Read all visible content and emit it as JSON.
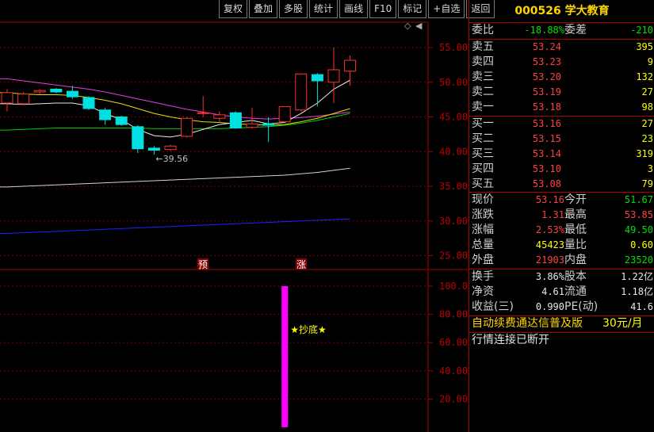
{
  "toolbar": [
    "复权",
    "叠加",
    "多股",
    "统计",
    "画线",
    "F10",
    "标记",
    "+自选",
    "返回"
  ],
  "price_axis": [
    "55.00",
    "50.00",
    "45.00",
    "40.00",
    "35.00",
    "30.00",
    "25.00"
  ],
  "indicator_axis": [
    "100.00",
    "80.00",
    "60.00",
    "40.00",
    "20.00"
  ],
  "markers": {
    "yu": "预",
    "zhang": "涨"
  },
  "low_label": "39.56",
  "signal_label": "★抄底★",
  "chart_data": {
    "type": "candlestick",
    "candles": [
      {
        "o": 47.0,
        "c": 48.5,
        "h": 49.0,
        "l": 45.8
      },
      {
        "o": 46.9,
        "c": 48.3,
        "h": 48.6,
        "l": 46.7
      },
      {
        "o": 48.6,
        "c": 48.8,
        "h": 49.0,
        "l": 48.3
      },
      {
        "o": 49.0,
        "c": 48.6,
        "h": 49.2,
        "l": 48.4
      },
      {
        "o": 48.7,
        "c": 47.9,
        "h": 49.5,
        "l": 47.6
      },
      {
        "o": 47.8,
        "c": 46.2,
        "h": 48.0,
        "l": 46.0
      },
      {
        "o": 46.0,
        "c": 44.6,
        "h": 46.3,
        "l": 43.9
      },
      {
        "o": 45.0,
        "c": 43.9,
        "h": 45.2,
        "l": 43.7
      },
      {
        "o": 43.6,
        "c": 40.4,
        "h": 43.8,
        "l": 39.8
      },
      {
        "o": 40.5,
        "c": 40.2,
        "h": 40.8,
        "l": 39.56
      },
      {
        "o": 40.3,
        "c": 40.8,
        "h": 41.0,
        "l": 40.1
      },
      {
        "o": 42.2,
        "c": 44.8,
        "h": 45.0,
        "l": 42.0
      },
      {
        "o": 45.6,
        "c": 45.6,
        "h": 48.0,
        "l": 45.0
      },
      {
        "o": 44.8,
        "c": 45.3,
        "h": 45.8,
        "l": 44.2
      },
      {
        "o": 45.6,
        "c": 43.4,
        "h": 45.8,
        "l": 43.3
      },
      {
        "o": 43.5,
        "c": 44.0,
        "h": 46.3,
        "l": 43.3
      },
      {
        "o": 44.0,
        "c": 43.8,
        "h": 45.0,
        "l": 41.4
      },
      {
        "o": 44.3,
        "c": 46.5,
        "h": 46.5,
        "l": 44.2
      },
      {
        "o": 46.0,
        "c": 51.2,
        "h": 51.3,
        "l": 45.8
      },
      {
        "o": 51.1,
        "c": 50.2,
        "h": 51.3,
        "l": 46.5
      },
      {
        "o": 50.0,
        "c": 51.8,
        "h": 55.0,
        "l": 47.0
      },
      {
        "o": 51.6,
        "c": 53.16,
        "h": 53.85,
        "l": 49.5
      }
    ],
    "ma_white": [
      46.9,
      46.8,
      46.9,
      47.0,
      47.0,
      46.6,
      45.5,
      44.6,
      43.2,
      42.3,
      42.1,
      42.5,
      43.2,
      43.9,
      44.2,
      44.5,
      44.0,
      44.2,
      45.5,
      47.0,
      49.0,
      50.3
    ],
    "ma_yellow": [
      48.5,
      48.3,
      48.2,
      48.2,
      48.1,
      47.8,
      47.4,
      46.9,
      46.2,
      45.5,
      45.0,
      44.6,
      44.3,
      44.2,
      44.0,
      43.9,
      43.8,
      43.9,
      44.3,
      44.8,
      45.5,
      46.2
    ],
    "ma_magenta": [
      50.5,
      50.2,
      49.9,
      49.6,
      49.3,
      49.0,
      48.6,
      48.1,
      47.6,
      47.1,
      46.6,
      46.1,
      45.7,
      45.3,
      45.0,
      44.8,
      44.7,
      44.8,
      44.9,
      45.1,
      45.4,
      45.7
    ],
    "ma_green": [
      43.1,
      43.2,
      43.3,
      43.4,
      43.4,
      43.4,
      43.4,
      43.4,
      43.4,
      43.3,
      43.3,
      43.3,
      43.3,
      43.3,
      43.4,
      43.5,
      43.6,
      43.8,
      44.1,
      44.5,
      45.0,
      45.5
    ],
    "ma_long_white": [
      34.9,
      35.0,
      35.1,
      35.2,
      35.3,
      35.4,
      35.5,
      35.6,
      35.7,
      35.8,
      35.9,
      36.0,
      36.1,
      36.2,
      36.3,
      36.4,
      36.5,
      36.6,
      36.8,
      37.0,
      37.3,
      37.6
    ],
    "ma_blue": [
      28.2,
      28.3,
      28.4,
      28.5,
      28.6,
      28.7,
      28.8,
      28.9,
      29.0,
      29.1,
      29.2,
      29.3,
      29.4,
      29.5,
      29.6,
      29.7,
      29.8,
      29.9,
      30.0,
      30.1,
      30.2,
      30.3
    ],
    "indicator_bar": {
      "index": 17,
      "value": 100
    }
  },
  "info": {
    "code_name": "000526 学大教育",
    "weibi": {
      "l1": "委比",
      "v1": "-18.88%",
      "l2": "委差",
      "v2": "-210"
    },
    "sells": [
      {
        "label": "卖五",
        "price": "53.24",
        "vol": "395"
      },
      {
        "label": "卖四",
        "price": "53.23",
        "vol": "9"
      },
      {
        "label": "卖三",
        "price": "53.20",
        "vol": "132"
      },
      {
        "label": "卖二",
        "price": "53.19",
        "vol": "27"
      },
      {
        "label": "卖一",
        "price": "53.18",
        "vol": "98"
      }
    ],
    "buys": [
      {
        "label": "买一",
        "price": "53.16",
        "vol": "27"
      },
      {
        "label": "买二",
        "price": "53.15",
        "vol": "23"
      },
      {
        "label": "买三",
        "price": "53.14",
        "vol": "319"
      },
      {
        "label": "买四",
        "price": "53.10",
        "vol": "3"
      },
      {
        "label": "买五",
        "price": "53.08",
        "vol": "79"
      }
    ],
    "quote": [
      {
        "l1": "现价",
        "v1": "53.16",
        "c1": "red",
        "l2": "今开",
        "v2": "51.67",
        "c2": "green"
      },
      {
        "l1": "涨跌",
        "v1": "1.31",
        "c1": "red",
        "l2": "最高",
        "v2": "53.85",
        "c2": "red"
      },
      {
        "l1": "涨幅",
        "v1": "2.53%",
        "c1": "red",
        "l2": "最低",
        "v2": "49.50",
        "c2": "green"
      },
      {
        "l1": "总量",
        "v1": "45423",
        "c1": "yellow",
        "l2": "量比",
        "v2": "0.60",
        "c2": "yellow"
      },
      {
        "l1": "外盘",
        "v1": "21903",
        "c1": "red",
        "l2": "内盘",
        "v2": "23520",
        "c2": "green"
      }
    ],
    "fund": [
      {
        "l1": "换手",
        "v1": "3.86%",
        "l2": "股本",
        "v2": "1.22亿"
      },
      {
        "l1": "净资",
        "v1": "4.61",
        "l2": "流通",
        "v2": "1.18亿"
      },
      {
        "l1": "收益(三)",
        "v1": "0.990",
        "l2": "PE(动)",
        "v2": "41.6"
      }
    ],
    "ad_text": "自动续费通达信普及版",
    "ad_price": "30元/月",
    "status": "行情连接已断开"
  }
}
